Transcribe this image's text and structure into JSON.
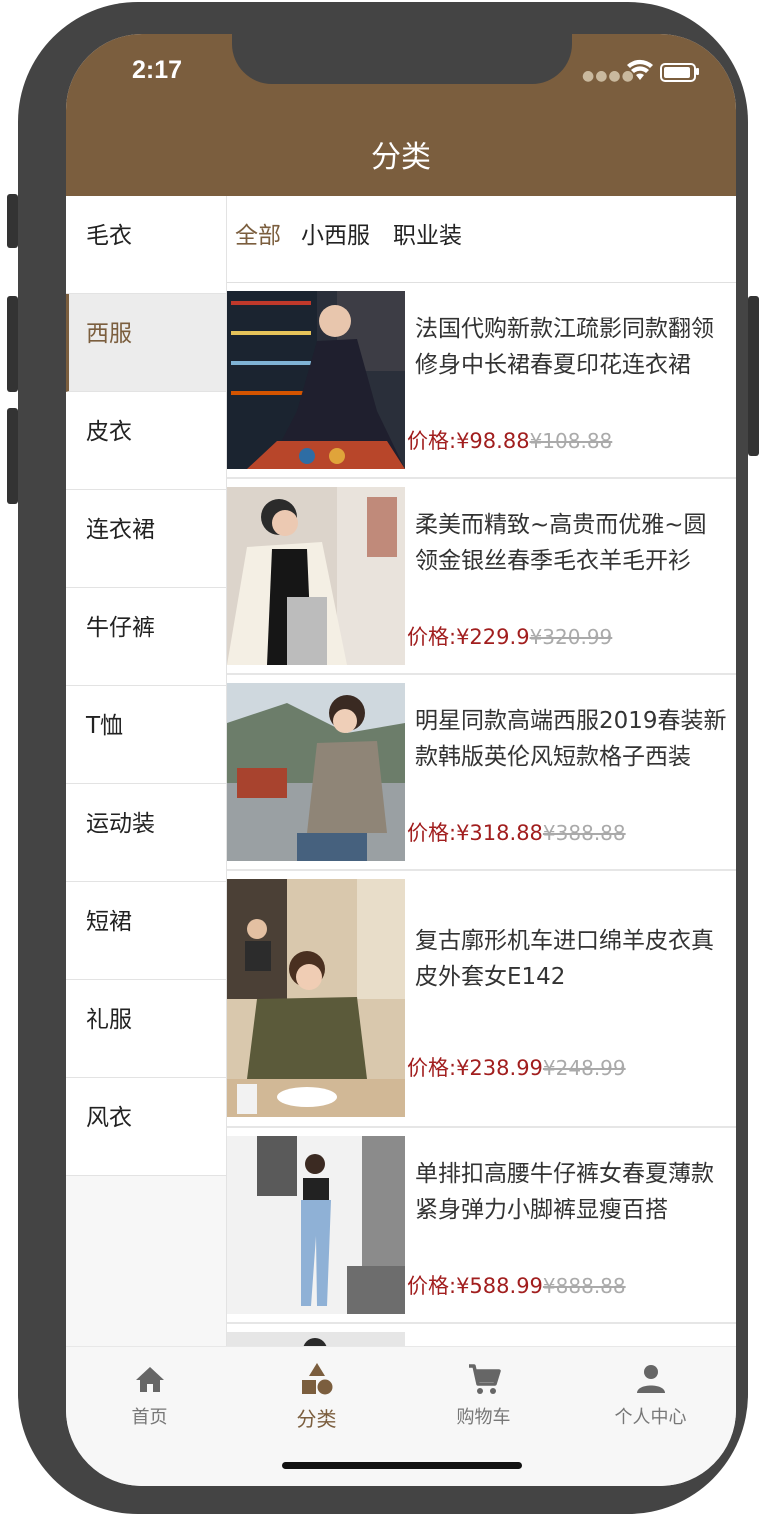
{
  "status": {
    "time": "2:17",
    "icons": [
      "signal-dots-icon",
      "wifi-icon",
      "battery-icon"
    ]
  },
  "header": {
    "title": "分类"
  },
  "colors": {
    "brand": "#7b5e3e",
    "price": "#a11e1e",
    "original_price": "#aaaaaa"
  },
  "sidebar": {
    "items": [
      {
        "label": "毛衣",
        "active": false
      },
      {
        "label": "西服",
        "active": true
      },
      {
        "label": "皮衣",
        "active": false
      },
      {
        "label": "连衣裙",
        "active": false
      },
      {
        "label": "牛仔裤",
        "active": false
      },
      {
        "label": "T恤",
        "active": false
      },
      {
        "label": "运动装",
        "active": false
      },
      {
        "label": "短裙",
        "active": false
      },
      {
        "label": "礼服",
        "active": false
      },
      {
        "label": "风衣",
        "active": false
      }
    ]
  },
  "subtabs": [
    {
      "label": "全部",
      "active": true
    },
    {
      "label": "小西服",
      "active": false
    },
    {
      "label": "职业装",
      "active": false
    }
  ],
  "products": [
    {
      "title": "法国代购新款江疏影同款翻领修身中长裙春夏印花连衣裙",
      "price_label": "价格:¥98.88",
      "original": "¥108.88"
    },
    {
      "title": "柔美而精致~高贵而优雅~圆领金银丝春季毛衣羊毛开衫",
      "price_label": "价格:¥229.9",
      "original": "¥320.99"
    },
    {
      "title": "明星同款高端西服2019春装新款韩版英伦风短款格子西装",
      "price_label": "价格:¥318.88",
      "original": "¥388.88"
    },
    {
      "title": "复古廓形机车进口绵羊皮衣真皮外套女E142",
      "price_label": "价格:¥238.99",
      "original": "¥248.99"
    },
    {
      "title": "单排扣高腰牛仔裤女春夏薄款紧身弹力小脚裤显瘦百搭",
      "price_label": "价格:¥588.99",
      "original": "¥888.88"
    }
  ],
  "tabbar": {
    "items": [
      {
        "label": "首页",
        "icon": "home-icon",
        "active": false
      },
      {
        "label": "分类",
        "icon": "category-icon",
        "active": true
      },
      {
        "label": "购物车",
        "icon": "cart-icon",
        "active": false
      },
      {
        "label": "个人中心",
        "icon": "person-icon",
        "active": false
      }
    ]
  }
}
